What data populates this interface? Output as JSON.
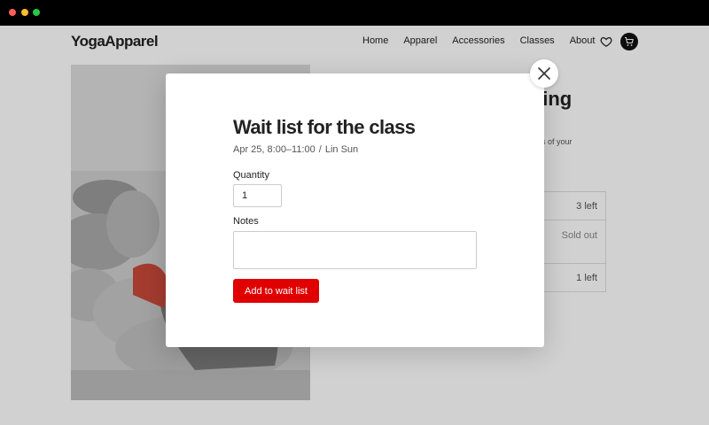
{
  "site": {
    "logo": "YogaApparel",
    "nav": [
      "Home",
      "Apparel",
      "Accessories",
      "Classes",
      "About"
    ],
    "icons": {
      "wishlist": "heart-icon",
      "cart": "cart-icon"
    }
  },
  "background": {
    "title_fragment": "cing",
    "subtitle_fragment": "ns of your",
    "rows": [
      "3 left",
      "Sold out",
      "1 left"
    ]
  },
  "modal": {
    "title": "Wait list for the class",
    "date": "Apr 25, 8:00–11:00",
    "separator": "/",
    "instructor": "Lin Sun",
    "quantity_label": "Quantity",
    "quantity_value": "1",
    "notes_label": "Notes",
    "notes_value": "",
    "submit_label": "Add to wait list",
    "close_icon": "close-icon"
  },
  "colors": {
    "accent": "#e00000",
    "text": "#222222"
  }
}
